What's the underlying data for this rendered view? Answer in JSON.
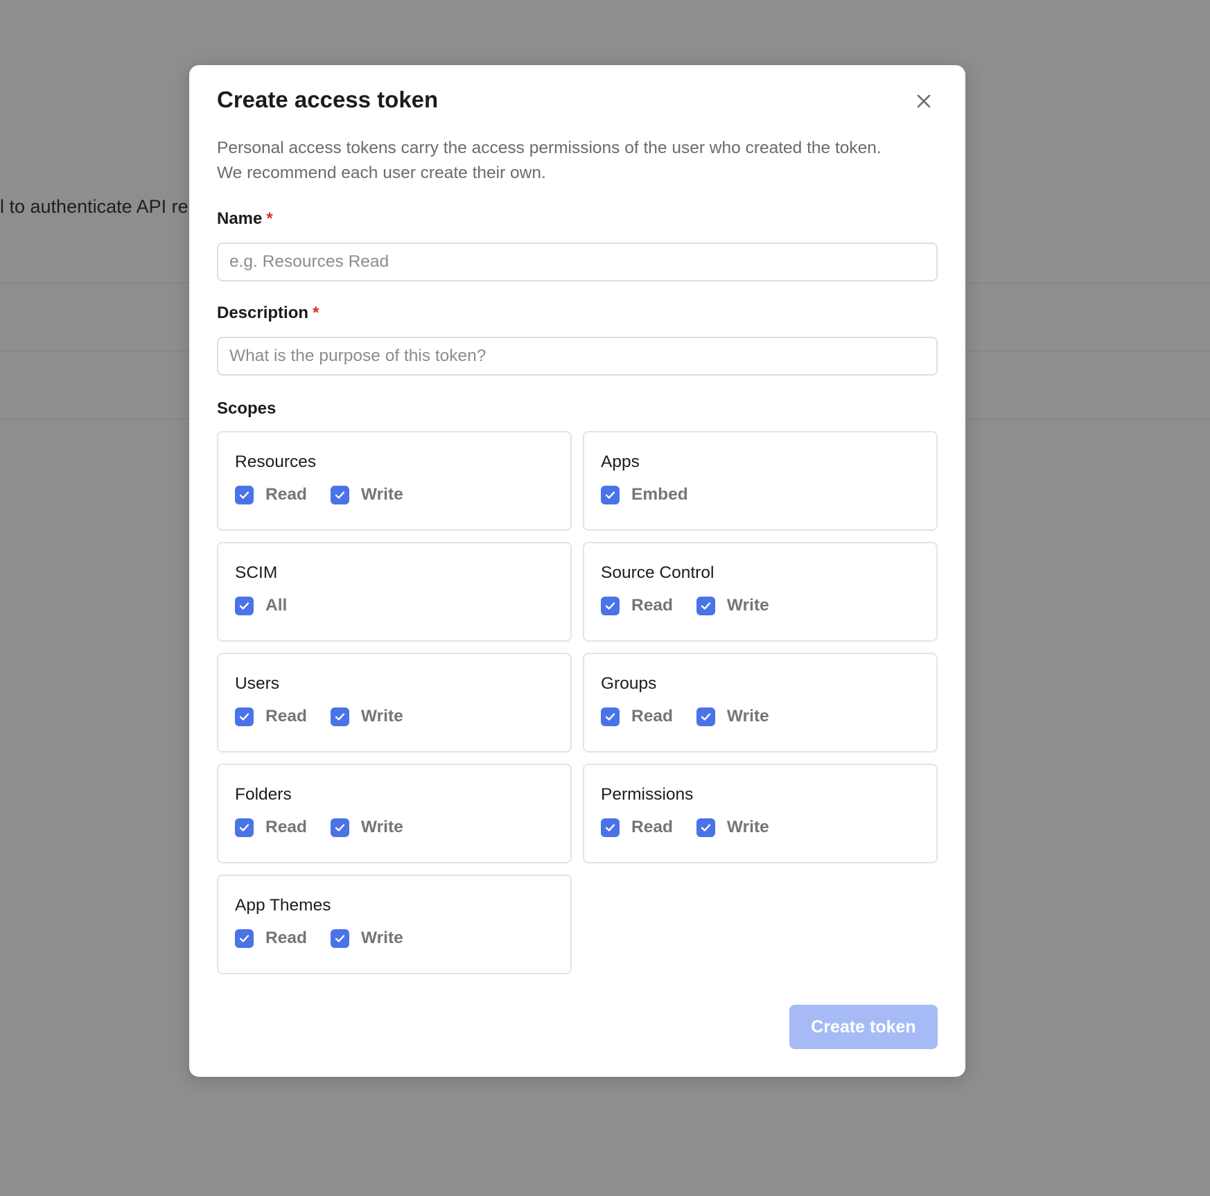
{
  "background": {
    "partial_text": "l to authenticate API re"
  },
  "modal": {
    "title": "Create access token",
    "close_icon": "close-icon",
    "intro_line1": "Personal access tokens carry the access permissions of the user who created the token.",
    "intro_line2": "We recommend each user create their own.",
    "name_field": {
      "label": "Name",
      "required_mark": "*",
      "value": "",
      "placeholder": "e.g. Resources Read"
    },
    "description_field": {
      "label": "Description",
      "required_mark": "*",
      "value": "",
      "placeholder": "What is the purpose of this token?"
    },
    "scopes_label": "Scopes",
    "scopes": [
      {
        "title": "Resources",
        "options": [
          {
            "label": "Read",
            "checked": true
          },
          {
            "label": "Write",
            "checked": true
          }
        ]
      },
      {
        "title": "Apps",
        "options": [
          {
            "label": "Embed",
            "checked": true
          }
        ]
      },
      {
        "title": "SCIM",
        "options": [
          {
            "label": "All",
            "checked": true
          }
        ]
      },
      {
        "title": "Source Control",
        "options": [
          {
            "label": "Read",
            "checked": true
          },
          {
            "label": "Write",
            "checked": true
          }
        ]
      },
      {
        "title": "Users",
        "options": [
          {
            "label": "Read",
            "checked": true
          },
          {
            "label": "Write",
            "checked": true
          }
        ]
      },
      {
        "title": "Groups",
        "options": [
          {
            "label": "Read",
            "checked": true
          },
          {
            "label": "Write",
            "checked": true
          }
        ]
      },
      {
        "title": "Folders",
        "options": [
          {
            "label": "Read",
            "checked": true
          },
          {
            "label": "Write",
            "checked": true
          }
        ]
      },
      {
        "title": "Permissions",
        "options": [
          {
            "label": "Read",
            "checked": true
          },
          {
            "label": "Write",
            "checked": true
          }
        ]
      },
      {
        "title": "App Themes",
        "options": [
          {
            "label": "Read",
            "checked": true
          },
          {
            "label": "Write",
            "checked": true
          }
        ]
      }
    ],
    "submit_label": "Create token",
    "submit_disabled": true
  },
  "colors": {
    "overlay": "#8e8e8e",
    "checkbox": "#4a73e8",
    "submit_disabled_bg": "#a6bbf6",
    "required": "#d93025"
  }
}
